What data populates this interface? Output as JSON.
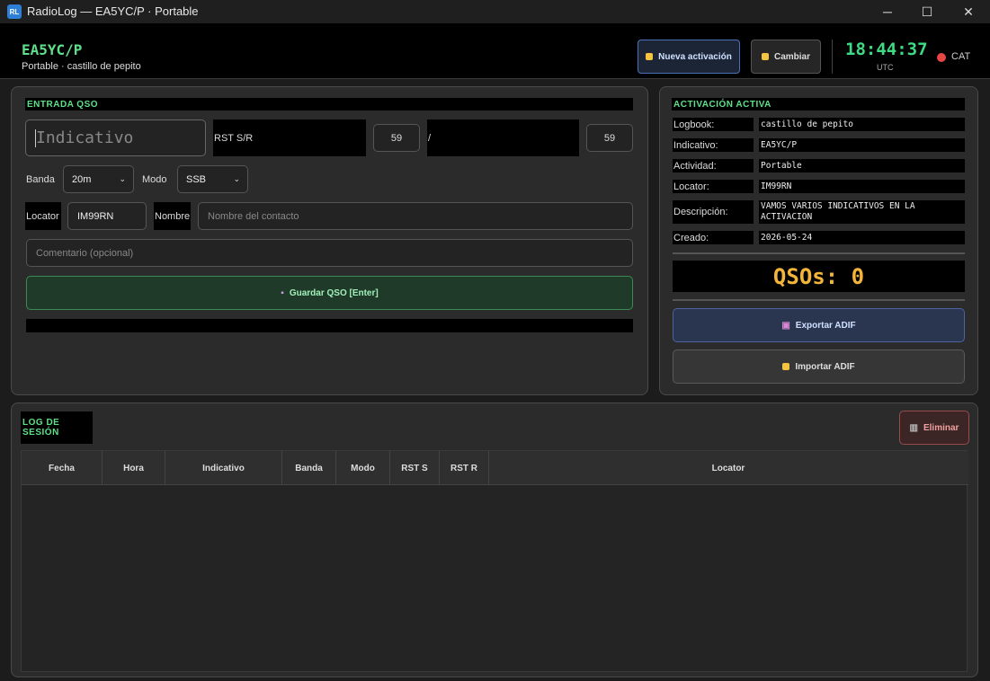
{
  "window": {
    "icon_text": "RL",
    "title": "RadioLog — EA5YC/P · Portable",
    "min": "─",
    "max": "☐",
    "close": "✕"
  },
  "header": {
    "callsign": "EA5YC/P",
    "subtitle": "Portable · castillo de pepito",
    "new_activation": "Nueva activación",
    "change": "Cambiar",
    "clock": "18:44:37",
    "utc": "UTC",
    "cat": "CAT"
  },
  "entry": {
    "title": "ENTRADA QSO",
    "callsign_placeholder": "Indicativo",
    "rst_label": "RST S/R",
    "rst_sent": "59",
    "slash": "/",
    "rst_rcvd": "59",
    "band_label": "Banda",
    "band_value": "20m",
    "mode_label": "Modo",
    "mode_value": "SSB",
    "locator_label": "Locator",
    "locator_value": "IM99RN",
    "name_label": "Nombre",
    "name_placeholder": "Nombre del contacto",
    "comment_placeholder": "Comentario (opcional)",
    "save_label": "Guardar QSO  [Enter]"
  },
  "activation": {
    "title": "ACTIVACIÓN ACTIVA",
    "rows": [
      {
        "label": "Logbook:",
        "value": "castillo de pepito"
      },
      {
        "label": "Indicativo:",
        "value": "EA5YC/P"
      },
      {
        "label": "Actividad:",
        "value": "Portable"
      },
      {
        "label": "Locator:",
        "value": "IM99RN"
      },
      {
        "label": "Descripción:",
        "value": "VAMOS VARIOS INDICATIVOS EN LA ACTIVACION"
      },
      {
        "label": "Creado:",
        "value": "2026-05-24"
      }
    ],
    "qso_count": "QSOs: 0",
    "export_label": "Exportar ADIF",
    "import_label": "Importar ADIF"
  },
  "log": {
    "title": "LOG DE SESIÓN",
    "delete_label": "Eliminar",
    "columns": [
      "Fecha",
      "Hora",
      "Indicativo",
      "Banda",
      "Modo",
      "RST S",
      "RST R",
      "Locator"
    ]
  }
}
